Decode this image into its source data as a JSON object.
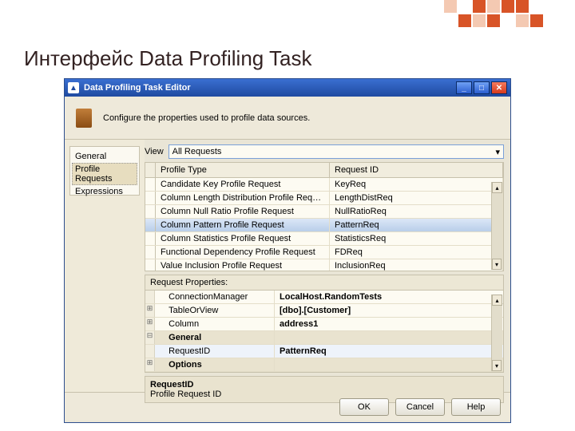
{
  "slide_title": "Интерфейс Data Profiling Task",
  "window_title": "Data Profiling Task Editor",
  "info_text": "Configure the properties used to profile data sources.",
  "side_nav": [
    "General",
    "Profile Requests",
    "Expressions"
  ],
  "side_nav_selected": 1,
  "view_label": "View",
  "view_value": "All Requests",
  "grid": {
    "headers": [
      "Profile Type",
      "Request ID"
    ],
    "rows": [
      {
        "type": "Candidate Key Profile Request",
        "id": "KeyReq"
      },
      {
        "type": "Column Length Distribution Profile Request",
        "id": "LengthDistReq"
      },
      {
        "type": "Column Null Ratio Profile Request",
        "id": "NullRatioReq"
      },
      {
        "type": "Column Pattern Profile Request",
        "id": "PatternReq",
        "selected": true
      },
      {
        "type": "Column Statistics Profile Request",
        "id": "StatisticsReq"
      },
      {
        "type": "Functional Dependency Profile Request",
        "id": "FDReq"
      },
      {
        "type": "Value Inclusion Profile Request",
        "id": "InclusionReq"
      }
    ]
  },
  "props_header": "Request Properties:",
  "props": [
    {
      "icon": "",
      "name": "ConnectionManager",
      "value": "LocalHost.RandomTests"
    },
    {
      "icon": "⊞",
      "name": "TableOrView",
      "value": "[dbo].[Customer]"
    },
    {
      "icon": "⊞",
      "name": "Column",
      "value": "address1"
    },
    {
      "icon": "⊟",
      "name": "General",
      "value": "",
      "cat": true
    },
    {
      "icon": "",
      "name": "RequestID",
      "value": "PatternReq",
      "selected": true
    },
    {
      "icon": "⊞",
      "name": "Options",
      "value": "",
      "cat": true
    }
  ],
  "help": {
    "name": "RequestID",
    "desc": "Profile Request ID"
  },
  "buttons": {
    "ok": "OK",
    "cancel": "Cancel",
    "help": "Help"
  }
}
